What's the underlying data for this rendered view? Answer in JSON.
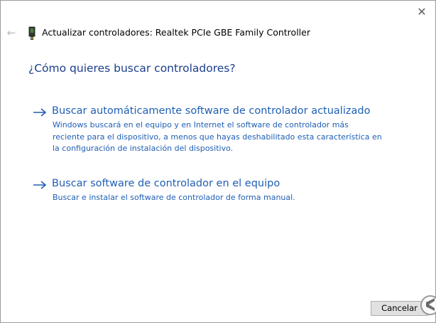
{
  "window": {
    "close_glyph": "✕",
    "back_glyph": "←"
  },
  "header": {
    "title": "Actualizar controladores: Realtek PCIe GBE Family Controller"
  },
  "main": {
    "question": "¿Cómo quieres buscar controladores?",
    "options": [
      {
        "title": "Buscar automáticamente software de controlador actualizado",
        "desc_lines": [
          "Windows buscará en el equipo y en Internet el software de controlador más",
          "reciente para el dispositivo, a menos que hayas deshabilitado esta característica en",
          "la configuración de instalación del dispositivo."
        ]
      },
      {
        "title": "Buscar software de controlador en el equipo",
        "desc_lines": [
          "Buscar e instalar el software de controlador de forma manual."
        ]
      }
    ]
  },
  "footer": {
    "cancel_label": "Cancelar"
  },
  "colors": {
    "question": "#1a3e8c",
    "link": "#1f5fb4",
    "button_bg": "#e1e1e1"
  },
  "icons": [
    "close-icon",
    "back-arrow-icon",
    "network-adapter-icon",
    "arrow-right-icon",
    "watermark-logo"
  ]
}
